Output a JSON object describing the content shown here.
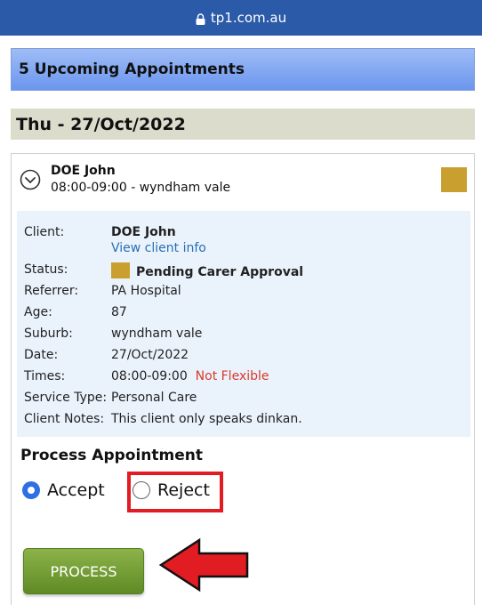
{
  "browser": {
    "url": "tp1.com.au"
  },
  "banner": {
    "text": "5 Upcoming Appointments"
  },
  "date_header": {
    "text": "Thu - 27/Oct/2022"
  },
  "appointment": {
    "name": "DOE John",
    "time_location": "08:00-09:00 - wyndham vale",
    "status_color": "#c9a030",
    "details": {
      "client_label": "Client:",
      "client_value": "DOE John",
      "view_client_link": "View client info",
      "status_label": "Status:",
      "status_value": "Pending Carer Approval",
      "referrer_label": "Referrer:",
      "referrer_value": "PA Hospital",
      "age_label": "Age:",
      "age_value": "87",
      "suburb_label": "Suburb:",
      "suburb_value": "wyndham vale",
      "date_label": "Date:",
      "date_value": "27/Oct/2022",
      "times_label": "Times:",
      "times_value": "08:00-09:00",
      "times_flex": "Not Flexible",
      "service_label": "Service Type:",
      "service_value": "Personal Care",
      "notes_label": "Client Notes:",
      "notes_value": "This client only speaks dinkan."
    }
  },
  "process": {
    "title": "Process Appointment",
    "accept_label": "Accept",
    "reject_label": "Reject",
    "accept_selected": true,
    "button_label": "PROCESS"
  },
  "annotations": {
    "highlight_color": "#e21c23"
  }
}
